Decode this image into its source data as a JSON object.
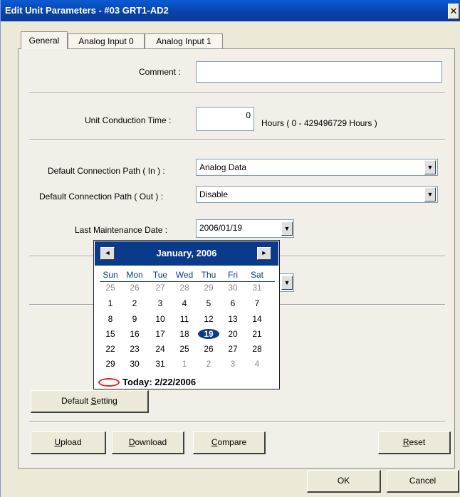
{
  "window": {
    "title": "Edit Unit Parameters - #03 GRT1-AD2",
    "close_glyph": "✕"
  },
  "tabs": [
    {
      "label": "General"
    },
    {
      "label": "Analog Input 0"
    },
    {
      "label": "Analog Input 1"
    }
  ],
  "general": {
    "comment_label": "Comment :",
    "comment_value": "",
    "conduction_label": "Unit Conduction Time :",
    "conduction_value": "0",
    "conduction_units": "Hours ( 0 - 429496729 Hours )",
    "path_in_label": "Default Connection Path ( In ) :",
    "path_in_value": "Analog Data",
    "path_out_label": "Default Connection Path ( Out ) :",
    "path_out_value": "Disable",
    "maint_label": "Last Maintenance Date :",
    "maint_value": "2006/01/19"
  },
  "calendar": {
    "month_label": "January, 2006",
    "prev_glyph": "◄",
    "next_glyph": "►",
    "weekdays": [
      "Sun",
      "Mon",
      "Tue",
      "Wed",
      "Thu",
      "Fri",
      "Sat"
    ],
    "weeks": [
      [
        "25",
        "26",
        "27",
        "28",
        "29",
        "30",
        "31"
      ],
      [
        "1",
        "2",
        "3",
        "4",
        "5",
        "6",
        "7"
      ],
      [
        "8",
        "9",
        "10",
        "11",
        "12",
        "13",
        "14"
      ],
      [
        "15",
        "16",
        "17",
        "18",
        "19",
        "20",
        "21"
      ],
      [
        "22",
        "23",
        "24",
        "25",
        "26",
        "27",
        "28"
      ],
      [
        "29",
        "30",
        "31",
        "1",
        "2",
        "3",
        "4"
      ]
    ],
    "selected_day": "19",
    "today_label": "Today: 2/22/2006"
  },
  "buttons": {
    "default_setting": {
      "before": "Default ",
      "key": "S",
      "after": "etting"
    },
    "upload": {
      "key": "U",
      "after": "pload"
    },
    "download": {
      "key": "D",
      "after": "ownload"
    },
    "compare": {
      "key": "C",
      "after": "ompare"
    },
    "reset": {
      "key": "R",
      "after": "eset"
    },
    "ok": "OK",
    "cancel": "Cancel"
  },
  "combo_arrow_glyph": "▼",
  "colors": {
    "titlebar": "#0842a8",
    "calendar_header": "#0a3a8a",
    "selected_day": "#0a3a8a",
    "today_ring": "#e02020"
  }
}
